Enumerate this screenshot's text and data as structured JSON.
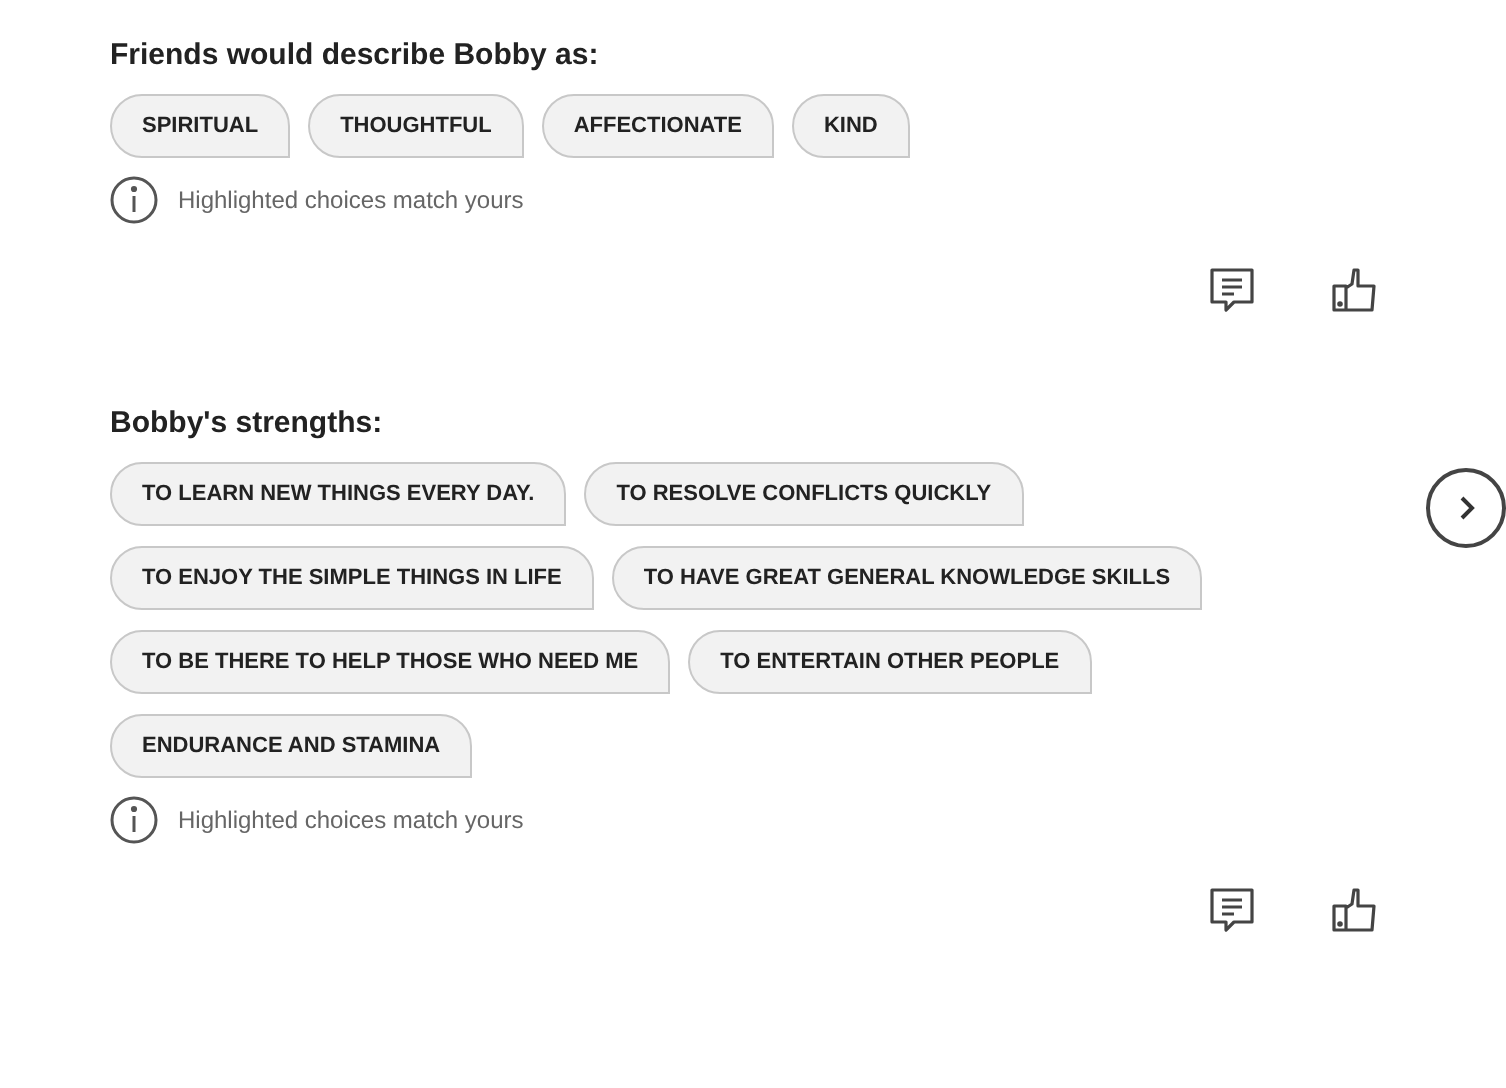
{
  "sections": [
    {
      "title": "Friends would describe Bobby as:",
      "chips": [
        {
          "label": "SPIRITUAL",
          "highlighted": false
        },
        {
          "label": "THOUGHTFUL",
          "highlighted": false
        },
        {
          "label": "AFFECTIONATE",
          "highlighted": false
        },
        {
          "label": "KIND",
          "highlighted": false
        }
      ],
      "note": "Highlighted choices match yours",
      "has_next": false
    },
    {
      "title": "Bobby's strengths:",
      "chips": [
        {
          "label": "TO LEARN NEW THINGS EVERY DAY.",
          "highlighted": false
        },
        {
          "label": "TO RESOLVE CONFLICTS QUICKLY",
          "highlighted": false
        },
        {
          "label": "TO ENJOY THE SIMPLE THINGS IN LIFE",
          "highlighted": false
        },
        {
          "label": "TO HAVE GREAT GENERAL KNOWLEDGE SKILLS",
          "highlighted": false
        },
        {
          "label": "TO BE THERE TO HELP THOSE WHO NEED ME",
          "highlighted": false
        },
        {
          "label": "TO ENTERTAIN OTHER PEOPLE",
          "highlighted": false
        },
        {
          "label": "ENDURANCE AND STAMINA",
          "highlighted": false
        }
      ],
      "note": "Highlighted choices match yours",
      "has_next": true
    }
  ]
}
